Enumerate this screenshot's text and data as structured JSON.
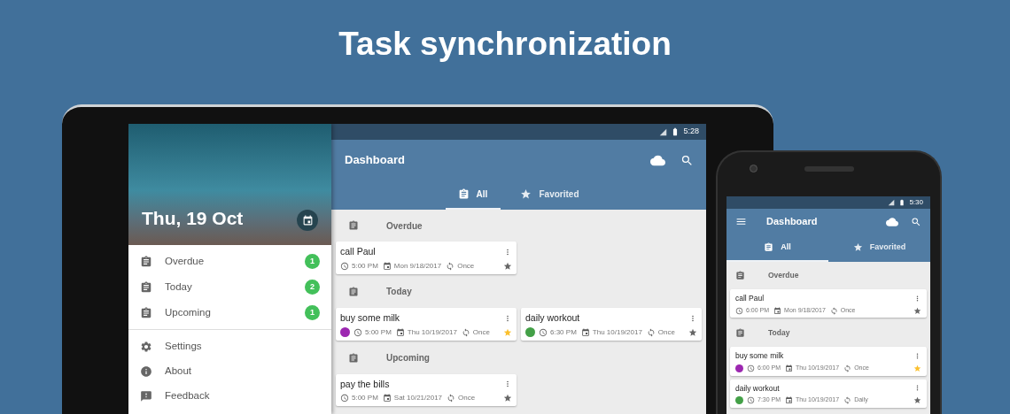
{
  "headline": "Task synchronization",
  "tablet": {
    "status_bar": {
      "time": "5:28"
    },
    "drawer": {
      "date": "Thu, 19 Oct",
      "lists": [
        {
          "label": "Overdue",
          "count": "1"
        },
        {
          "label": "Today",
          "count": "2"
        },
        {
          "label": "Upcoming",
          "count": "1"
        }
      ],
      "menu": [
        {
          "label": "Settings",
          "kind": "settings"
        },
        {
          "label": "About",
          "kind": "about"
        },
        {
          "label": "Feedback",
          "kind": "feedback"
        }
      ]
    },
    "app_bar": {
      "title": "Dashboard"
    },
    "tabs": [
      {
        "label": "All",
        "kind": "all",
        "selected": true
      },
      {
        "label": "Favorited",
        "kind": "favorites",
        "selected": false
      }
    ],
    "sections": [
      {
        "title": "Overdue",
        "tasks": [
          {
            "title": "call Paul",
            "time": "5:00 PM",
            "date": "Mon 9/18/2017",
            "repeat": "Once",
            "favorite": false
          }
        ]
      },
      {
        "title": "Today",
        "tasks": [
          {
            "title": "buy some milk",
            "color": "#9c27b0",
            "time": "5:00 PM",
            "date": "Thu 10/19/2017",
            "repeat": "Once",
            "favorite": true
          },
          {
            "title": "daily workout",
            "color": "#43a047",
            "time": "6:30 PM",
            "date": "Thu 10/19/2017",
            "repeat": "Once",
            "favorite": false
          }
        ]
      },
      {
        "title": "Upcoming",
        "tasks": [
          {
            "title": "pay the bills",
            "time": "5:00 PM",
            "date": "Sat 10/21/2017",
            "repeat": "Once",
            "favorite": false
          }
        ]
      }
    ]
  },
  "phone": {
    "status_bar": {
      "time": "5:30"
    },
    "app_bar": {
      "title": "Dashboard"
    },
    "tabs": [
      {
        "label": "All",
        "kind": "all",
        "selected": true
      },
      {
        "label": "Favorited",
        "kind": "favorites",
        "selected": false
      }
    ],
    "sections": [
      {
        "title": "Overdue",
        "tasks": [
          {
            "title": "call Paul",
            "time": "6:00 PM",
            "date": "Mon 9/18/2017",
            "repeat": "Once",
            "favorite": false
          }
        ]
      },
      {
        "title": "Today",
        "tasks": [
          {
            "title": "buy some milk",
            "color": "#9c27b0",
            "time": "6:00 PM",
            "date": "Thu 10/19/2017",
            "repeat": "Once",
            "favorite": true
          },
          {
            "title": "daily workout",
            "color": "#43a047",
            "time": "7:30 PM",
            "date": "Thu 10/19/2017",
            "repeat": "Daily",
            "favorite": false
          }
        ]
      }
    ]
  }
}
